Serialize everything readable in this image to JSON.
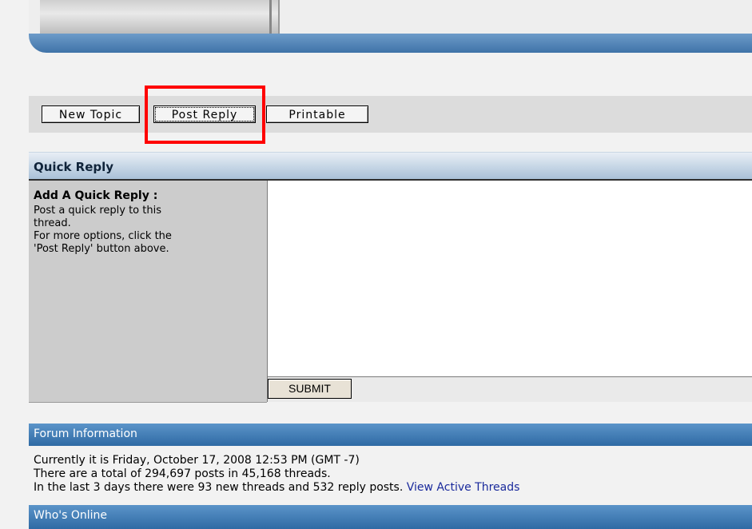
{
  "toolbar": {
    "new_topic": "New Topic",
    "post_reply": "Post Reply",
    "printable": "Printable"
  },
  "quick_reply": {
    "header": "Quick Reply",
    "label_title": "Add A Quick Reply :",
    "description_lines": [
      "Post a quick reply to this",
      "thread.",
      "For more options, click the",
      "'Post Reply' button above."
    ],
    "textarea_value": "",
    "submit_label": "SUBMIT"
  },
  "forum_info": {
    "header": "Forum Information",
    "line1": "Currently it is Friday, October 17, 2008 12:53 PM (GMT -7)",
    "line2": "There are a total of 294,697 posts in 45,168 threads.",
    "line3": "In the last 3 days there were 93 new threads and 532 reply posts.",
    "link": "View Active Threads"
  },
  "whos_online": {
    "header": "Who's Online"
  },
  "colors": {
    "highlight": "#ff0000",
    "header_blue": "#3f73a8",
    "link": "#1a2a9c"
  }
}
